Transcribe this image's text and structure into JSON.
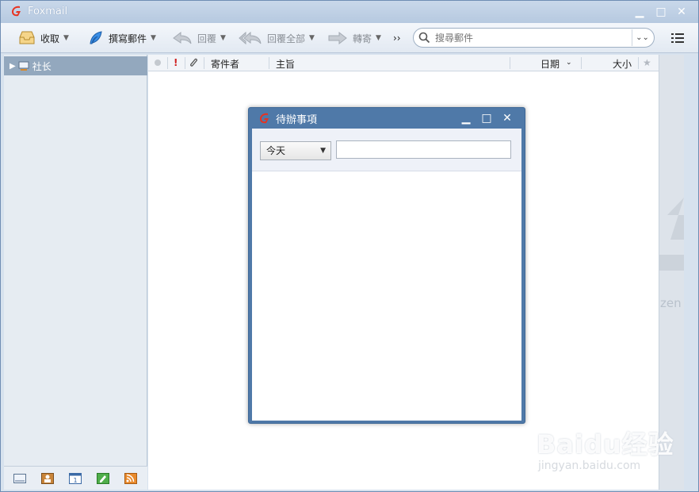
{
  "app": {
    "title": "Foxmail"
  },
  "toolbar": {
    "receive": "收取",
    "compose": "撰寫郵件",
    "reply": "回覆",
    "reply_all": "回覆全部",
    "forward": "轉寄",
    "more": "››",
    "search_placeholder": "搜尋郵件"
  },
  "sidebar": {
    "account": "社长"
  },
  "maillist": {
    "columns": {
      "sender": "寄件者",
      "subject": "主旨",
      "date": "日期",
      "size": "大小"
    }
  },
  "todo_dialog": {
    "title": "待辦事項",
    "filter_value": "今天",
    "filter_text": ""
  },
  "watermark": {
    "logo": "Baidu经验",
    "url": "jingyan.baidu.com",
    "side_fragment": "zen"
  }
}
